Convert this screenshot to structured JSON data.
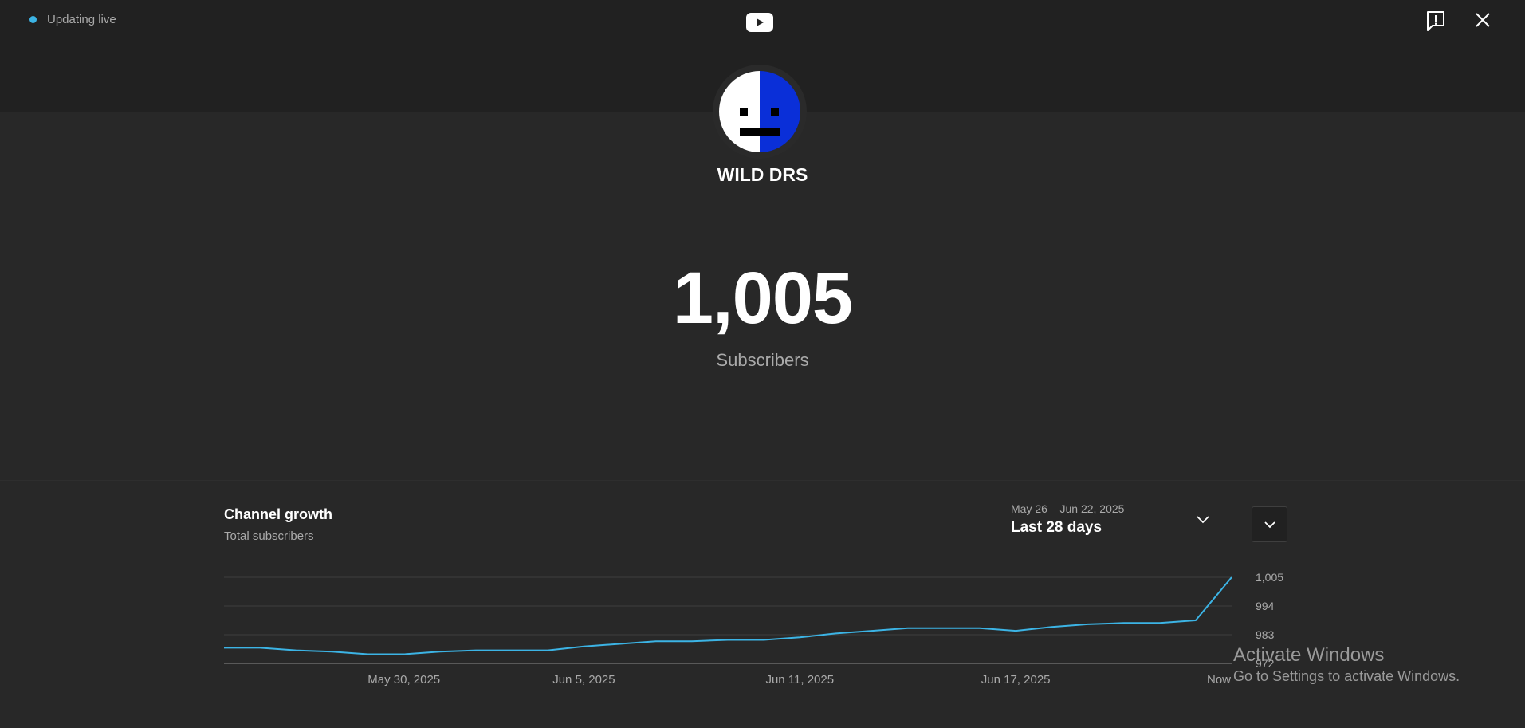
{
  "header": {
    "live_status": "Updating live",
    "logo_icon": "youtube-logo-icon",
    "feedback_icon": "feedback-icon",
    "close_icon": "close-icon"
  },
  "channel": {
    "name": "WILD DRS",
    "subscriber_count": "1,005",
    "subscriber_label": "Subscribers"
  },
  "growth": {
    "title": "Channel growth",
    "subtitle": "Total subscribers",
    "range_dates": "May 26 – Jun 22, 2025",
    "range_label": "Last 28 days"
  },
  "chart_data": {
    "type": "line",
    "x_tick_labels": [
      "May 30, 2025",
      "Jun 5, 2025",
      "Jun 11, 2025",
      "Jun 17, 2025",
      "Now"
    ],
    "x_tick_index": [
      5,
      10,
      16,
      22,
      28
    ],
    "y_ticks": [
      1005,
      994,
      983,
      972
    ],
    "y_tick_labels": [
      "1,005",
      "994",
      "983",
      "972"
    ],
    "ylim": [
      972,
      1005
    ],
    "grid": true,
    "series": [
      {
        "values": [
          978,
          978,
          977,
          976.5,
          975.5,
          975.5,
          976.5,
          977,
          977,
          977,
          978.5,
          979.5,
          980.5,
          980.5,
          981,
          981,
          982,
          983.5,
          984.5,
          985.5,
          985.5,
          985.5,
          984.5,
          986,
          987,
          987.5,
          987.5,
          988.5,
          1005
        ],
        "color": "#3cb4e5"
      }
    ]
  },
  "overlay": {
    "activate_title": "Activate Windows",
    "activate_sub": "Go to Settings to activate Windows."
  }
}
